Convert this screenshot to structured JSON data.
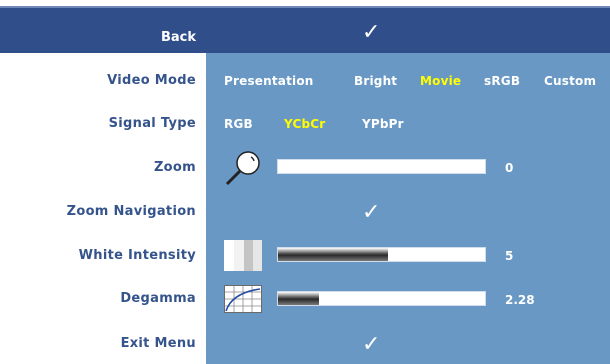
{
  "menu": {
    "back": {
      "label": "Back",
      "icon": "checkmark-icon"
    },
    "video_mode": {
      "label": "Video Mode",
      "options": [
        "Presentation",
        "Bright",
        "Movie",
        "sRGB",
        "Custom"
      ],
      "selected": "Movie"
    },
    "signal_type": {
      "label": "Signal Type",
      "options": [
        "RGB",
        "YCbCr",
        "YPbPr"
      ],
      "selected": "YCbCr"
    },
    "zoom": {
      "label": "Zoom",
      "icon": "magnifier-icon",
      "value": "0",
      "level": 0
    },
    "zoom_navigation": {
      "label": "Zoom Navigation",
      "icon": "checkmark-icon"
    },
    "white_intensity": {
      "label": "White Intensity",
      "icon": "white-intensity-icon",
      "value": "5",
      "level": 0.53
    },
    "degamma": {
      "label": "Degamma",
      "icon": "degamma-curve-icon",
      "value": "2.28",
      "level": 0.2
    },
    "exit_menu": {
      "label": "Exit Menu",
      "icon": "checkmark-icon"
    }
  },
  "colors": {
    "header_bg": "#2f4e8a",
    "panel_bg": "#6a98c4",
    "label_text": "#35548c",
    "selected_option": "#ffff00",
    "option_text": "#ffffff"
  }
}
